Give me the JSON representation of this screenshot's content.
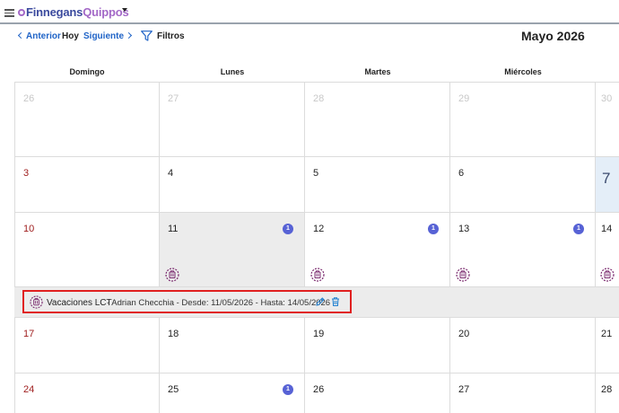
{
  "app": {
    "brand_primary": "Finnegans",
    "brand_secondary": "Quippos"
  },
  "toolbar": {
    "prev_label": "Anterior",
    "today_label": "Hoy",
    "next_label": "Siguiente",
    "filter_label": "Filtros",
    "month_title": "Mayo 2026"
  },
  "calendar": {
    "headers": [
      "Domingo",
      "Lunes",
      "Martes",
      "Miércoles",
      ""
    ],
    "weeks": [
      [
        "26",
        "27",
        "28",
        "29",
        "30"
      ],
      [
        "3",
        "4",
        "5",
        "6",
        "7"
      ],
      [
        "10",
        "11",
        "12",
        "13",
        "14"
      ],
      [
        "17",
        "18",
        "19",
        "20",
        "21"
      ],
      [
        "24",
        "25",
        "26",
        "27",
        "28"
      ]
    ],
    "week3_badges": [
      "1",
      "1",
      "1"
    ],
    "week5_badge": "1"
  },
  "event_detail": {
    "title": "Vacaciones LCT",
    "description": "- Adrian Checchia - Desde: 11/05/2026 - Hasta: 14/05/2026"
  },
  "colors": {
    "accent_blue": "#1f63c7",
    "badge": "#5762d5",
    "event_icon": "#7a2a6e",
    "sunday": "#a02020",
    "highlight_border": "#e02020",
    "today_bg": "#e4eef8"
  }
}
